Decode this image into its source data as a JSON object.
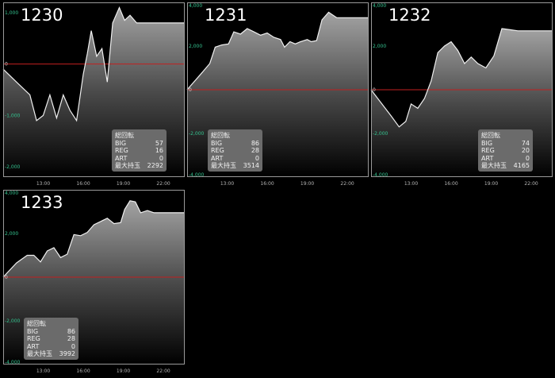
{
  "colors": {
    "ytick_positive": "#34c38f",
    "ytick_zero": "#cccccc",
    "zero_line": "#c21f1f",
    "line": "#f0f0f0",
    "frame": "#9a9a9a"
  },
  "stats_labels": {
    "header": "総回転",
    "big": "BIG",
    "reg": "REG",
    "art": "ART",
    "max": "最大持玉"
  },
  "chart_data": [
    {
      "type": "area",
      "title": "1230",
      "ylim": [
        -2200,
        1200
      ],
      "yticks": [
        1000,
        0,
        -1000,
        -2000
      ],
      "ytick_labels": [
        "1,000",
        "0",
        "-1,000",
        "-2,000"
      ],
      "xlim": [
        10.0,
        23.6
      ],
      "xticks": [
        13,
        16,
        19,
        22
      ],
      "xtick_labels": [
        "13:00",
        "16:00",
        "19:00",
        "22:00"
      ],
      "x": [
        10.0,
        11.0,
        12.0,
        12.5,
        13.0,
        13.5,
        14.0,
        14.5,
        15.0,
        15.5,
        16.0,
        16.3,
        16.6,
        17.0,
        17.4,
        17.8,
        18.2,
        18.7,
        19.1,
        19.5,
        20.0,
        20.5,
        21.0,
        22.0,
        23.6
      ],
      "y": [
        -100,
        -350,
        -600,
        -1100,
        -1000,
        -600,
        -1050,
        -600,
        -900,
        -1100,
        -200,
        200,
        650,
        150,
        300,
        -350,
        800,
        1100,
        850,
        950,
        800,
        800,
        800,
        800,
        800
      ],
      "stats": {
        "big": 57,
        "reg": 16,
        "art": 0,
        "max": 2292
      }
    },
    {
      "type": "area",
      "title": "1231",
      "ylim": [
        -4000,
        4000
      ],
      "yticks": [
        4000,
        2000,
        0,
        -2000,
        -4000
      ],
      "ytick_labels": [
        "4,000",
        "2,000",
        "0",
        "-2,000",
        "-4,000"
      ],
      "xlim": [
        10.0,
        23.6
      ],
      "xticks": [
        13,
        16,
        19,
        22
      ],
      "xtick_labels": [
        "13:00",
        "16:00",
        "19:00",
        "22:00"
      ],
      "x": [
        10.0,
        11.0,
        11.7,
        12.1,
        12.6,
        13.1,
        13.5,
        14.0,
        14.5,
        15.0,
        15.5,
        16.0,
        16.5,
        17.0,
        17.3,
        17.7,
        18.1,
        18.5,
        19.0,
        19.3,
        19.7,
        20.1,
        20.6,
        21.2,
        22.0,
        23.6
      ],
      "y": [
        0,
        700,
        1200,
        1950,
        2050,
        2100,
        2650,
        2550,
        2800,
        2650,
        2500,
        2600,
        2400,
        2300,
        1950,
        2200,
        2100,
        2200,
        2300,
        2200,
        2250,
        3200,
        3550,
        3300,
        3300,
        3300
      ],
      "stats": {
        "big": 86,
        "reg": 28,
        "art": 0,
        "max": 3514
      }
    },
    {
      "type": "area",
      "title": "1232",
      "ylim": [
        -4000,
        4000
      ],
      "yticks": [
        4000,
        2000,
        0,
        -2000,
        -4000
      ],
      "ytick_labels": [
        "4,000",
        "2,000",
        "0",
        "-2,000",
        "-4,000"
      ],
      "xlim": [
        10.0,
        23.6
      ],
      "xticks": [
        13,
        16,
        19,
        22
      ],
      "xtick_labels": [
        "13:00",
        "16:00",
        "19:00",
        "22:00"
      ],
      "x": [
        10.0,
        11.5,
        12.1,
        12.6,
        13.0,
        13.5,
        14.0,
        14.5,
        15.0,
        15.5,
        16.0,
        16.5,
        17.0,
        17.5,
        18.0,
        18.6,
        19.2,
        19.8,
        20.4,
        21.0,
        22.0,
        23.6
      ],
      "y": [
        0,
        -1200,
        -1700,
        -1450,
        -650,
        -850,
        -400,
        400,
        1700,
        2000,
        2200,
        1800,
        1200,
        1500,
        1200,
        1000,
        1550,
        2800,
        2750,
        2700,
        2700,
        2700
      ],
      "stats": {
        "big": 74,
        "reg": 20,
        "art": 0,
        "max": 4165
      }
    },
    {
      "type": "area",
      "title": "1233",
      "ylim": [
        -4000,
        4000
      ],
      "yticks": [
        4000,
        2000,
        0,
        -2000,
        -4000
      ],
      "ytick_labels": [
        "4,000",
        "2,000",
        "0",
        "-2,000",
        "-4,000"
      ],
      "xlim": [
        10.0,
        23.6
      ],
      "xticks": [
        13,
        16,
        19,
        22
      ],
      "xtick_labels": [
        "13:00",
        "16:00",
        "19:00",
        "22:00"
      ],
      "x": [
        10.0,
        11.0,
        11.8,
        12.3,
        12.8,
        13.3,
        13.8,
        14.3,
        14.8,
        15.3,
        15.8,
        16.3,
        16.8,
        17.3,
        17.8,
        18.3,
        18.8,
        19.1,
        19.5,
        19.9,
        20.3,
        20.8,
        21.3,
        22.0,
        23.6
      ],
      "y": [
        0,
        650,
        1000,
        1000,
        700,
        1200,
        1350,
        900,
        1050,
        1950,
        1900,
        2050,
        2400,
        2550,
        2700,
        2450,
        2500,
        3100,
        3500,
        3450,
        2950,
        3050,
        2950,
        2950,
        2950
      ],
      "stats": {
        "big": 86,
        "reg": 28,
        "art": 0,
        "max": 3992
      }
    }
  ]
}
